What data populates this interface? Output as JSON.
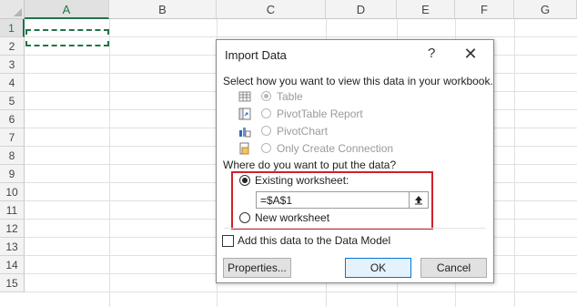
{
  "sheet": {
    "columns": [
      "A",
      "B",
      "C",
      "D",
      "E",
      "F",
      "G"
    ],
    "rows": [
      "1",
      "2",
      "3",
      "4",
      "5",
      "6",
      "7",
      "8",
      "9",
      "10",
      "11",
      "12",
      "13",
      "14",
      "15"
    ],
    "accent": "#217346"
  },
  "dialog": {
    "title": "Import Data",
    "help": "?",
    "close": "✕",
    "view_prompt": "Select how you want to view this data in your workbook.",
    "view_options": [
      {
        "label": "Table",
        "selected": true,
        "icon": "table-icon"
      },
      {
        "label": "PivotTable Report",
        "selected": false,
        "icon": "pivottable-icon"
      },
      {
        "label": "PivotChart",
        "selected": false,
        "icon": "pivotchart-icon"
      },
      {
        "label": "Only Create Connection",
        "selected": false,
        "icon": "connection-icon"
      }
    ],
    "location_prompt": "Where do you want to put the data?",
    "existing_label": "Existing worksheet:",
    "existing_selected": true,
    "cell_ref": "=$A$1",
    "new_label": "New worksheet",
    "data_model_label": "Add this data to the Data Model",
    "properties_button": "Properties...",
    "ok_button": "OK",
    "cancel_button": "Cancel",
    "highlight_color": "#d11f2c"
  }
}
